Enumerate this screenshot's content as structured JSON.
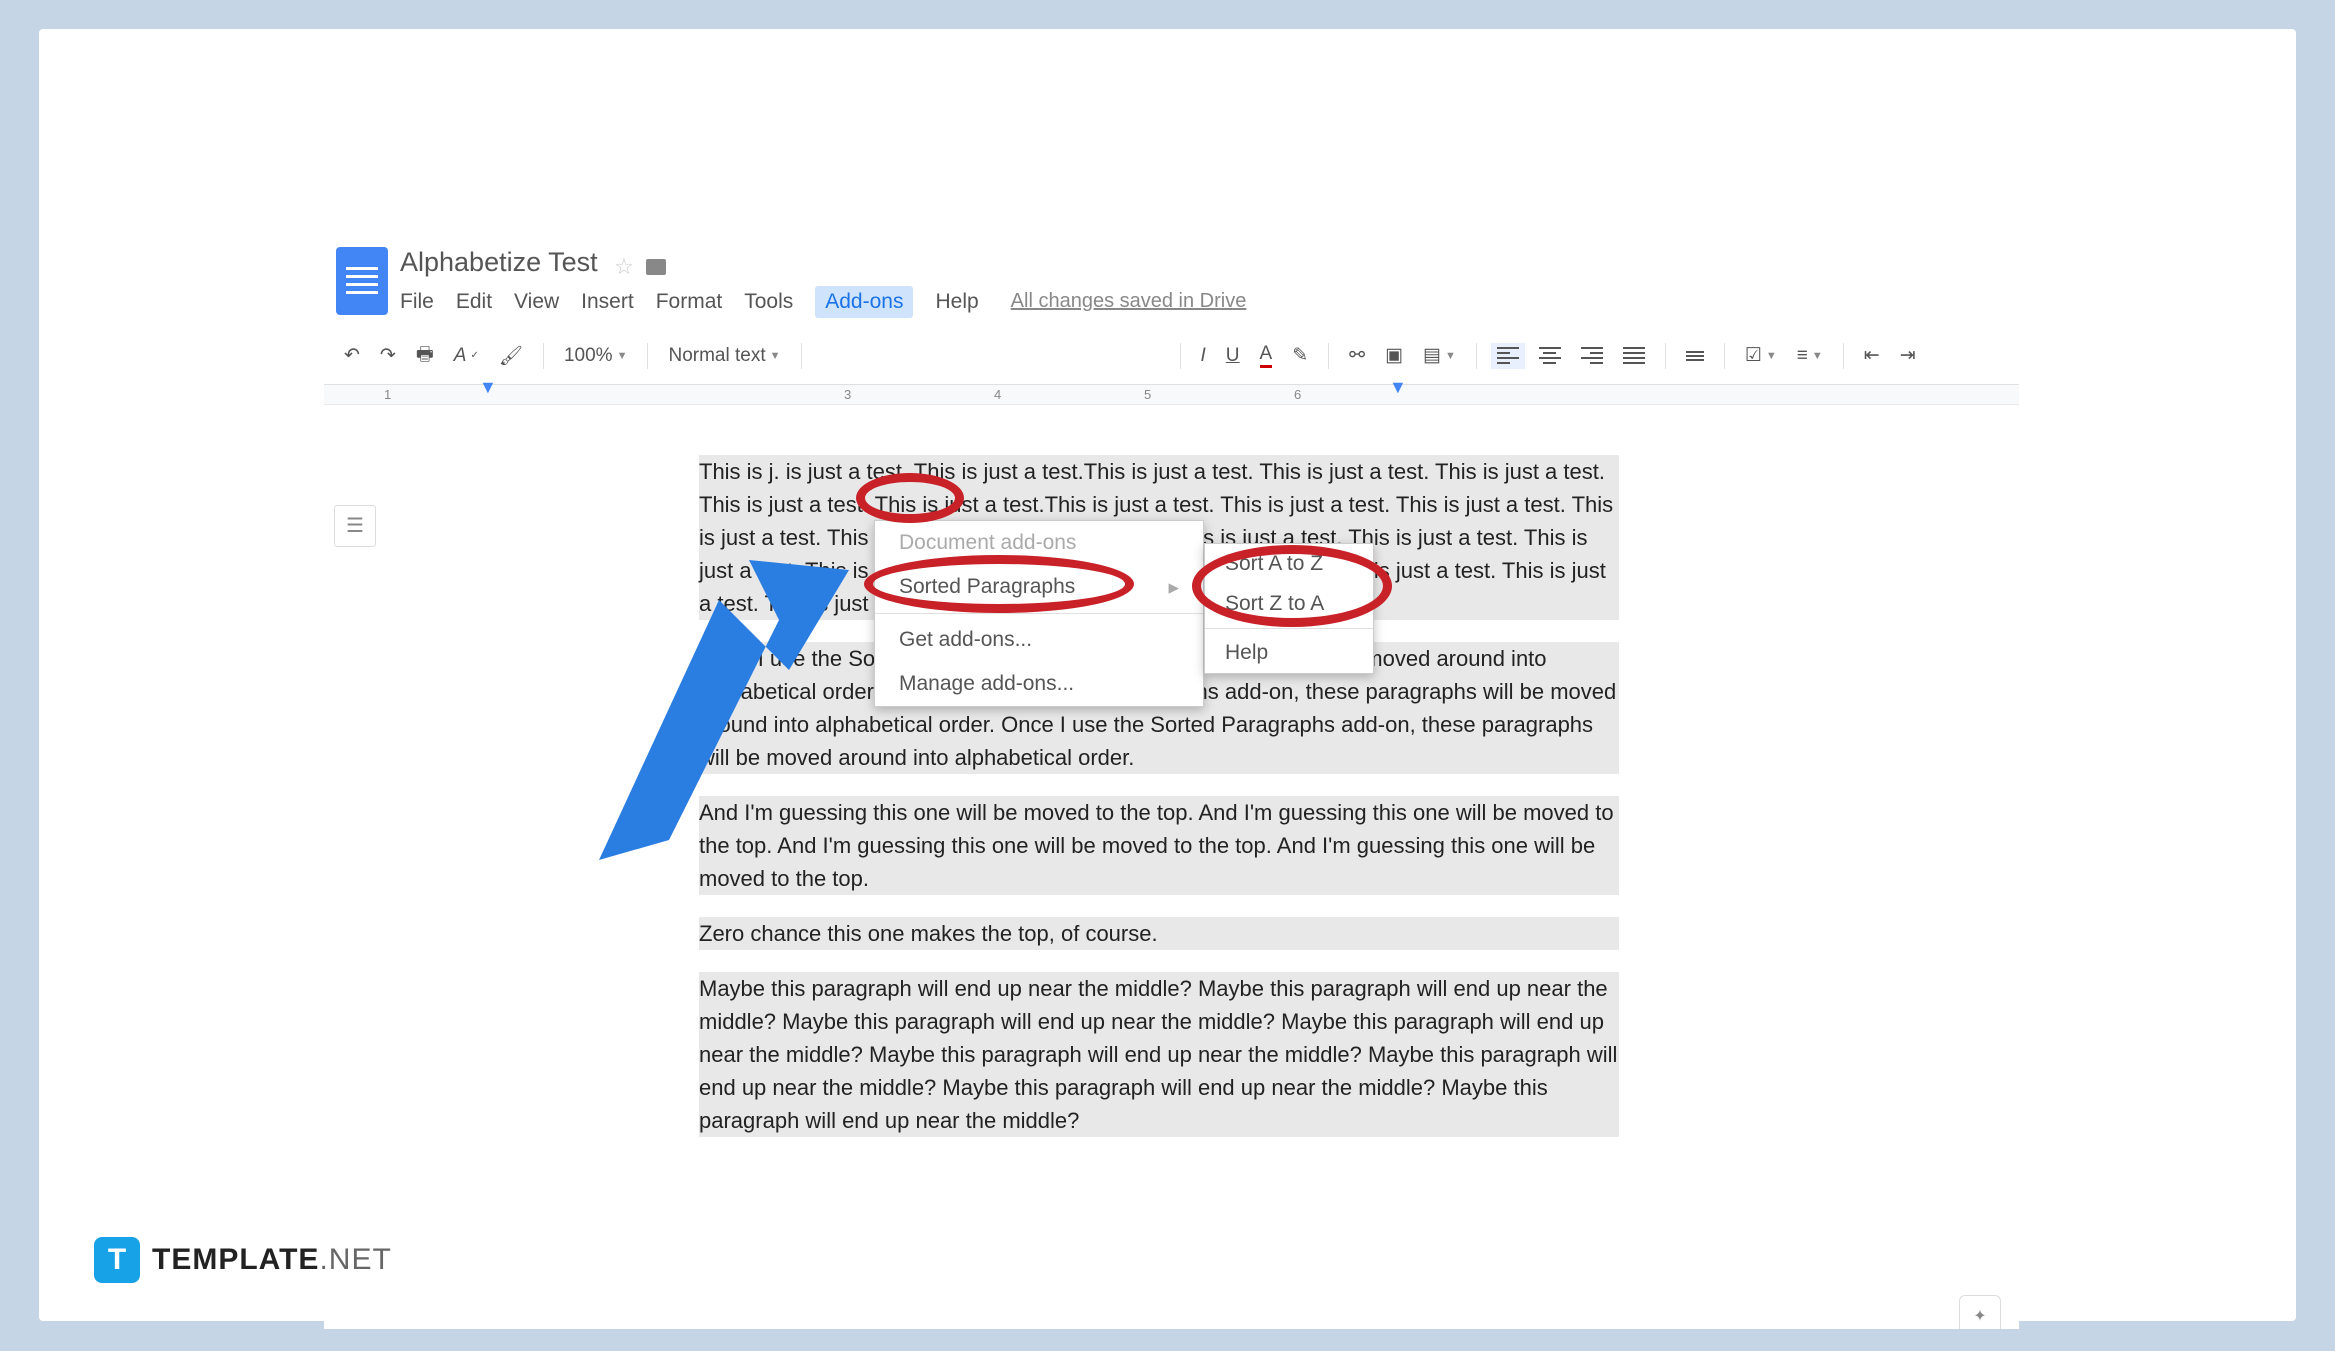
{
  "header": {
    "title": "Alphabetize Test",
    "saved_msg": "All changes saved in Drive"
  },
  "menus": {
    "file": "File",
    "edit": "Edit",
    "view": "View",
    "insert": "Insert",
    "format": "Format",
    "tools": "Tools",
    "addons": "Add-ons",
    "help": "Help"
  },
  "toolbar": {
    "zoom": "100%",
    "style": "Normal text"
  },
  "dropdown": {
    "heading": "Document add-ons",
    "sorted": "Sorted Paragraphs",
    "get": "Get add-ons...",
    "manage": "Manage add-ons..."
  },
  "submenu": {
    "sort_az": "Sort A to Z",
    "sort_za": "Sort Z to A",
    "help": "Help"
  },
  "ruler": {
    "n1": "1",
    "n3": "3",
    "n4": "4",
    "n5": "5",
    "n6": "6"
  },
  "paragraphs": {
    "p1": "This is j.                                                                                          is just a test. This is just a test.This is just a test. This is just a test. This is just a test. This is just a test. This is just a test.This is just a test. This is just a test. This is just a test. This is just a test. This is just a test.This is just a test. This is just a test. This is just a test. This is just a test. This is just a test.This is just a test. This is just a test. This is just a test. This is just a test. This is just a test.",
    "p2": "Once I use the Sorted Paragraphs add-on, these paragraphs will be moved around into alphabetical order. Once I use the Sorted Paragraphs add-on, these paragraphs will be moved around into alphabetical order. Once I use the Sorted Paragraphs add-on, these paragraphs will be moved around into alphabetical order.",
    "p3": "And I'm guessing this one will be moved to the top. And I'm guessing this one will be moved to the top. And I'm guessing this one will be moved to the top. And I'm guessing this one will be moved to the top.",
    "p4": "Zero chance this one makes the top, of course.",
    "p5": "Maybe this paragraph will end up near the middle? Maybe this paragraph will end up near the middle? Maybe this paragraph will end up near the middle? Maybe this paragraph will end up near the middle? Maybe this paragraph will end up near the middle? Maybe this paragraph will end up near the middle? Maybe this paragraph will end up near the middle? Maybe this paragraph will end up near the middle?"
  },
  "watermark": {
    "logo": "T",
    "brand": "TEMPLATE",
    "suffix": ".NET"
  }
}
